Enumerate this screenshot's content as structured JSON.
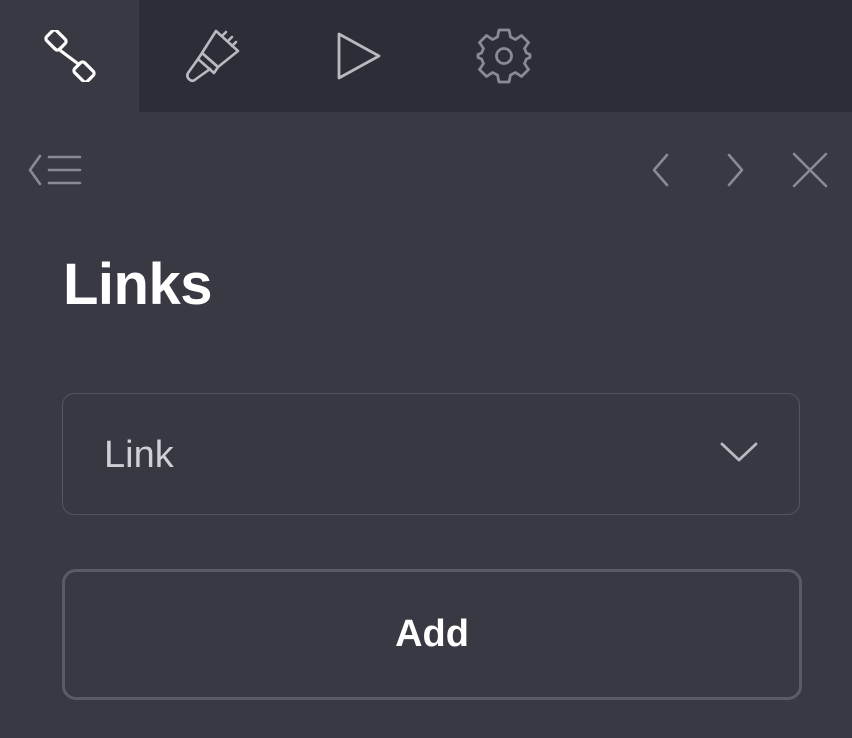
{
  "tabs": [
    {
      "icon": "link-icon",
      "active": true
    },
    {
      "icon": "paintbrush-icon",
      "active": false
    },
    {
      "icon": "play-icon",
      "active": false
    },
    {
      "icon": "gear-icon",
      "active": false
    }
  ],
  "nav": {
    "menu_icon": "back-menu-icon",
    "prev_icon": "chevron-left-icon",
    "next_icon": "chevron-right-icon",
    "close_icon": "close-icon"
  },
  "panel": {
    "title": "Links",
    "select": {
      "value": "Link"
    },
    "add_label": "Add"
  },
  "colors": {
    "background": "#393944",
    "tabbar": "#2d2d37",
    "text": "#ffffff",
    "icon_active": "#ffffff",
    "icon_muted": "#8a8a95"
  }
}
